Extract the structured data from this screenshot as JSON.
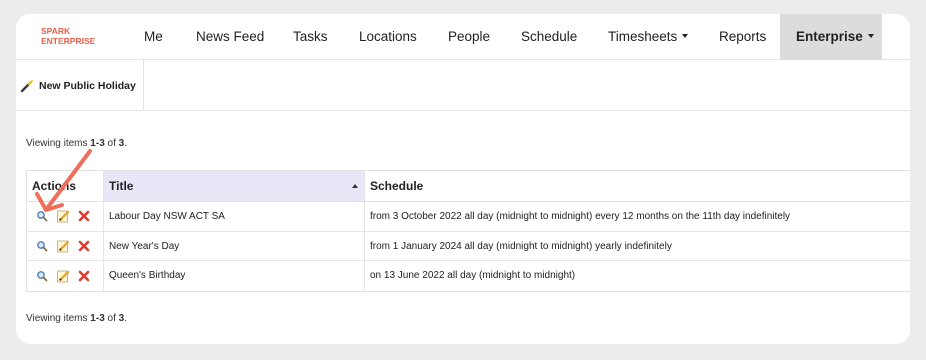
{
  "nav": {
    "brand_line1": "SPARK",
    "brand_line2": "ENTERPRISE",
    "items": [
      {
        "label": "Me"
      },
      {
        "label": "News Feed"
      },
      {
        "label": "Tasks"
      },
      {
        "label": "Locations"
      },
      {
        "label": "People"
      },
      {
        "label": "Schedule"
      },
      {
        "label": "Timesheets"
      },
      {
        "label": "Reports"
      },
      {
        "label": "Enterprise"
      }
    ]
  },
  "toolbar": {
    "new_button_label": "New Public Holiday",
    "new_button_icon": "magic-wand-icon"
  },
  "summary": {
    "prefix": "Viewing items ",
    "range": "1-3",
    "middle": " of ",
    "total": "3",
    "suffix": "."
  },
  "table": {
    "headers": {
      "actions": "Actions",
      "title": "Title",
      "schedule": "Schedule"
    },
    "rows": [
      {
        "title": "Labour Day NSW ACT SA",
        "schedule": "from 3 October 2022 all day (midnight to midnight) every 12 months on the 11th day indefinitely"
      },
      {
        "title": "New Year's Day",
        "schedule": "from 1 January 2024 all day (midnight to midnight) yearly indefinitely"
      },
      {
        "title": "Queen's Birthday",
        "schedule": "on 13 June 2022 all day (midnight to midnight)"
      }
    ],
    "action_icons": [
      "view-magnifier-icon",
      "edit-pencil-icon",
      "delete-x-icon"
    ]
  },
  "colors": {
    "brand": "#e8604c",
    "active_tab_bg": "#dcdcdc",
    "sorted_header_bg": "#e9e6f8",
    "annotation_arrow": "#ef6f5c",
    "delete_icon": "#e23b2e"
  }
}
